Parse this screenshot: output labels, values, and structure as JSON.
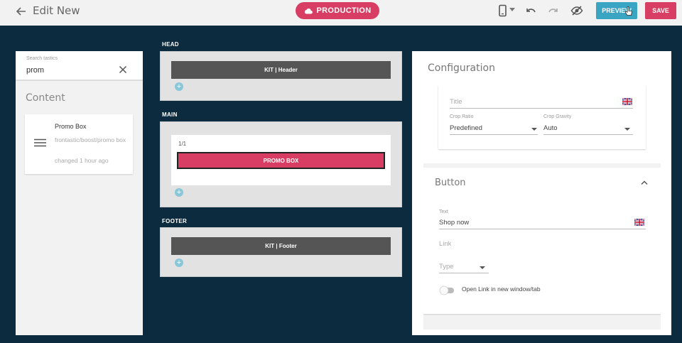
{
  "topbar": {
    "title": "Edit New",
    "environment": "PRODUCTION",
    "preview_label": "PREVIEW",
    "save_label": "SAVE",
    "icons": [
      "back-arrow-icon",
      "cloud-icon",
      "mobile-device-icon",
      "undo-icon",
      "redo-icon",
      "eye-off-icon"
    ]
  },
  "sidebar": {
    "search_label": "Search tastics",
    "search_value": "prom",
    "heading": "Content",
    "tastics": [
      {
        "name": "Promo Box",
        "path": "frontastic/boost/promo box",
        "changed": "changed 1 hour ago"
      }
    ]
  },
  "layout": {
    "regions": [
      {
        "label": "HEAD",
        "kit": "KIT | Header"
      },
      {
        "label": "MAIN",
        "cell": "1/1",
        "tastic": "PROMO BOX"
      },
      {
        "label": "FOOTER",
        "kit": "KIT | Footer"
      }
    ]
  },
  "config": {
    "title": "Configuration",
    "image": {
      "title_placeholder": "Title",
      "crop_ratio_label": "Crop Ratio",
      "crop_ratio_value": "Predefined",
      "crop_gravity_label": "Crop Gravity",
      "crop_gravity_value": "Auto"
    },
    "button": {
      "heading": "Button",
      "text_label": "Text",
      "text_value": "Shop now",
      "link_label": "Link",
      "type_placeholder": "Type",
      "new_window_label": "Open Link in new window/tab",
      "new_window_on": false
    }
  },
  "colors": {
    "accent_pink": "#d83d63",
    "preview_blue": "#3aa4c3",
    "background_navy": "#0d2b3e"
  }
}
